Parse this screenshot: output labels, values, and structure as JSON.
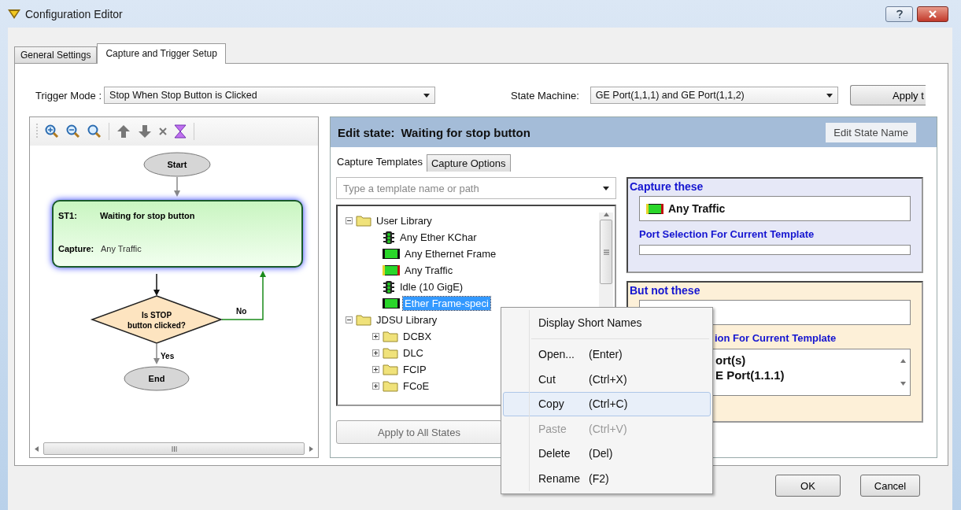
{
  "window": {
    "title": "Configuration Editor"
  },
  "tabs": [
    {
      "label": "General Settings",
      "selected": false
    },
    {
      "label": "Capture and Trigger Setup",
      "selected": true
    }
  ],
  "trigger": {
    "label": "Trigger Mode :",
    "value": "Stop When Stop Button is Clicked"
  },
  "state_machine": {
    "label": "State Machine:",
    "value": "GE Port(1,1,1) and GE Port(1,1,2)"
  },
  "apply_button": "Apply t",
  "flowchart": {
    "start": "Start",
    "state": {
      "id": "ST1:",
      "name": "Waiting for stop button",
      "capture_label": "Capture:",
      "capture_value": "Any Traffic",
      "selected": true
    },
    "decision": [
      "Is STOP",
      "button clicked?"
    ],
    "no_label": "No",
    "yes_label": "Yes",
    "end": "End"
  },
  "editor": {
    "title_label": "Edit state:",
    "title_value": "Waiting for stop button",
    "edit_name_button": "Edit State Name",
    "tabs": [
      {
        "label": "Capture Templates",
        "selected": true
      },
      {
        "label": "Capture Options",
        "selected": false
      }
    ],
    "template_search": {
      "placeholder": "Type a template name or path"
    },
    "tree": [
      {
        "label": "User Library",
        "kind": "folder",
        "expanded": true,
        "selected": false,
        "children": [
          {
            "label": "Any Ether KChar",
            "kind": "signal",
            "selected": false
          },
          {
            "label": "Any Ethernet Frame",
            "kind": "frame",
            "selected": false
          },
          {
            "label": "Any Traffic",
            "kind": "traffic",
            "selected": false
          },
          {
            "label": "Idle (10 GigE)",
            "kind": "signal",
            "selected": false
          },
          {
            "label": "Ether Frame-speci",
            "kind": "frame",
            "selected": true
          }
        ]
      },
      {
        "label": "JDSU Library",
        "kind": "folder",
        "expanded": true,
        "selected": false,
        "children": [
          {
            "label": "DCBX",
            "kind": "folder",
            "expanded": false,
            "selected": false
          },
          {
            "label": "DLC",
            "kind": "folder",
            "expanded": false,
            "selected": false
          },
          {
            "label": "FCIP",
            "kind": "folder",
            "expanded": false,
            "selected": false
          },
          {
            "label": "FCoE",
            "kind": "folder",
            "expanded": false,
            "selected": false
          }
        ]
      }
    ],
    "capture_these": {
      "title": "Capture these",
      "items": [
        {
          "label": "Any Traffic",
          "kind": "traffic"
        }
      ],
      "port_heading": "Port Selection For Current Template"
    },
    "but_not_these": {
      "title": "But not these",
      "port_heading": "ion For Current Template",
      "ports": [
        "ort(s)",
        "E Port(1.1.1)"
      ]
    },
    "apply_all_button": "Apply to All States"
  },
  "context_menu": [
    {
      "label": "Display Short Names",
      "kind": "item",
      "disabled": false,
      "selected": false
    },
    {
      "kind": "separator"
    },
    {
      "label": "Open...",
      "shortcut": "(Enter)",
      "kind": "item",
      "disabled": false,
      "selected": false
    },
    {
      "label": "Cut",
      "shortcut": "(Ctrl+X)",
      "kind": "item",
      "disabled": false,
      "selected": false
    },
    {
      "label": "Copy",
      "shortcut": "(Ctrl+C)",
      "kind": "item",
      "disabled": false,
      "selected": true
    },
    {
      "label": "Paste",
      "shortcut": "(Ctrl+V)",
      "kind": "item",
      "disabled": true,
      "selected": false
    },
    {
      "label": "Delete",
      "shortcut": "(Del)",
      "kind": "item",
      "disabled": false,
      "selected": false
    },
    {
      "label": "Rename",
      "shortcut": "(F2)",
      "kind": "item",
      "disabled": false,
      "selected": false
    }
  ],
  "buttons": [
    "OK",
    "Cancel"
  ]
}
